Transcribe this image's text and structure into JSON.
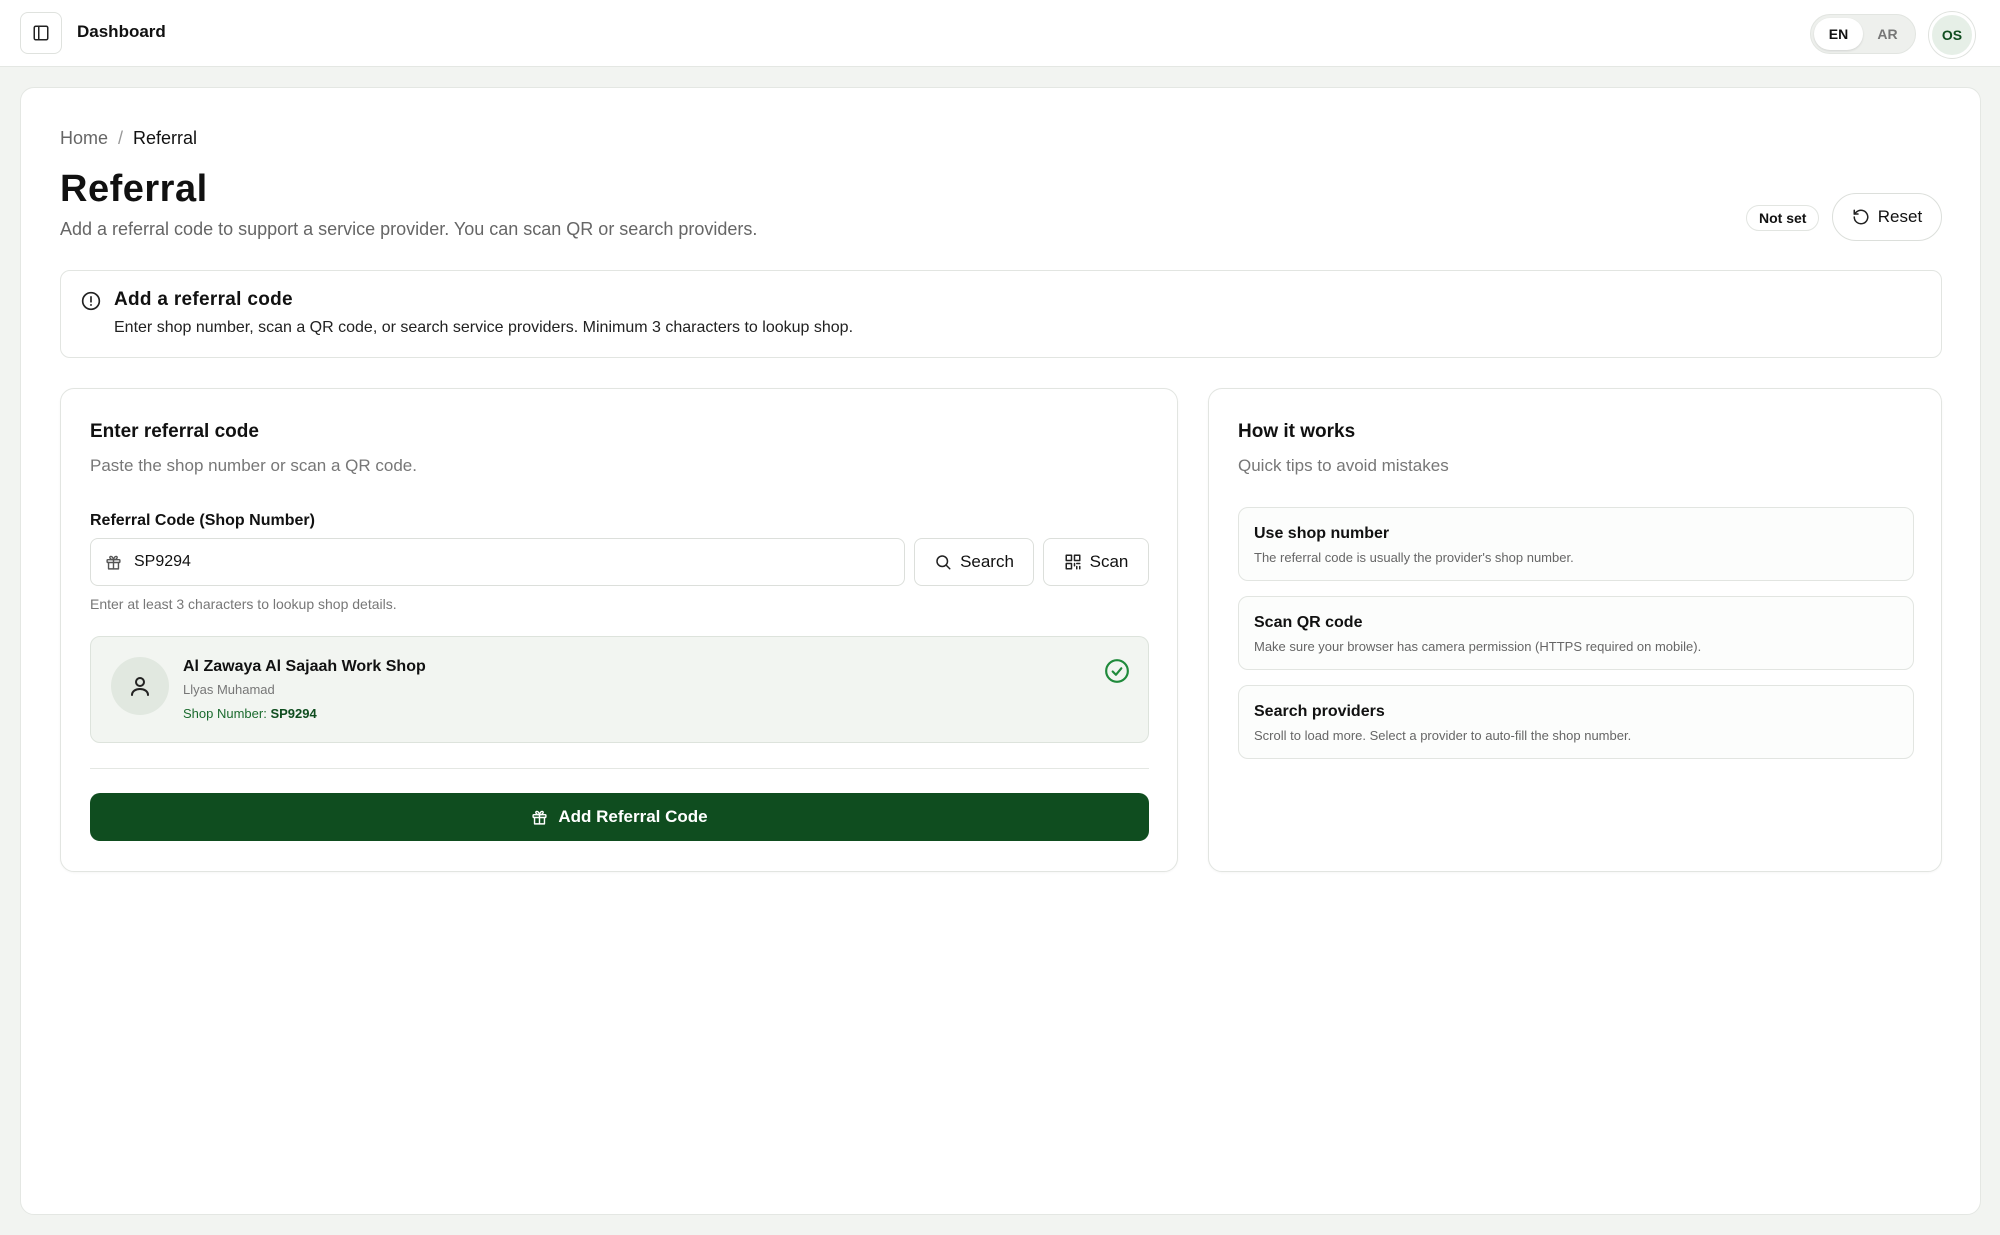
{
  "header": {
    "title": "Dashboard",
    "languages": [
      "EN",
      "AR"
    ],
    "active_language": "EN",
    "user_initials": "OS"
  },
  "breadcrumb": {
    "home": "Home",
    "separator": "/",
    "current": "Referral"
  },
  "page": {
    "title": "Referral",
    "subtitle": "Add a referral code to support a service provider. You can scan QR or search providers.",
    "status": "Not set",
    "reset_label": "Reset"
  },
  "alert": {
    "title": "Add a referral code",
    "text": "Enter shop number, scan a QR code, or search service providers. Minimum 3 characters to lookup shop."
  },
  "referral_form": {
    "title": "Enter referral code",
    "subtitle": "Paste the shop number or scan a QR code.",
    "field_label": "Referral Code (Shop Number)",
    "field_value": "SP9294",
    "search_label": "Search",
    "scan_label": "Scan",
    "hint": "Enter at least 3 characters to lookup shop details.",
    "provider": {
      "name": "Al Zawaya Al Sajaah Work Shop",
      "owner": "Llyas Muhamad",
      "shop_label": "Shop Number:",
      "shop_number": "SP9294"
    },
    "submit_label": "Add Referral Code"
  },
  "how_it_works": {
    "title": "How it works",
    "subtitle": "Quick tips to avoid mistakes",
    "tips": [
      {
        "title": "Use shop number",
        "text": "The referral code is usually the provider's shop number."
      },
      {
        "title": "Scan QR code",
        "text": "Make sure your browser has camera permission (HTTPS required on mobile)."
      },
      {
        "title": "Search providers",
        "text": "Scroll to load more. Select a provider to auto-fill the shop number."
      }
    ]
  },
  "colors": {
    "primary": "#0f4d1f",
    "success": "#1f8a3b"
  }
}
